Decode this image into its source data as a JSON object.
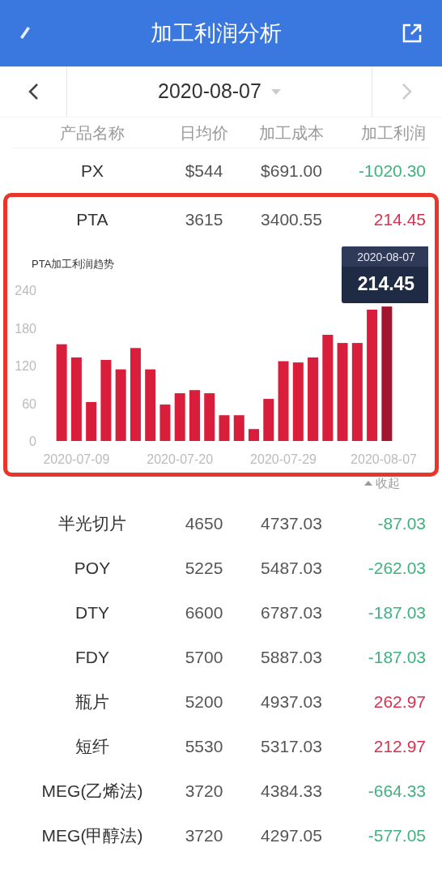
{
  "header": {
    "title": "加工利润分析"
  },
  "date_bar": {
    "date": "2020-08-07"
  },
  "table": {
    "columns": [
      "产品名称",
      "日均价",
      "加工成本",
      "加工利润"
    ],
    "rows": [
      {
        "name": "PX",
        "price": "$544",
        "cost": "$691.00",
        "profit": "-1020.30",
        "color": "#3fb27f",
        "expanded": false
      },
      {
        "name": "PTA",
        "price": "3615",
        "cost": "3400.55",
        "profit": "214.45",
        "color": "#d9304f",
        "expanded": true,
        "chart": {
          "tooltip": {
            "title": "2020-08-07",
            "value": "214.45"
          },
          "collapse_label": "收起",
          "chart_data": {
            "type": "bar",
            "title": "PTA加工利润趋势",
            "categories": [
              null,
              "2020-07-09",
              null,
              null,
              null,
              null,
              null,
              null,
              "2020-07-20",
              null,
              null,
              null,
              null,
              null,
              null,
              "2020-07-29",
              null,
              null,
              null,
              null,
              null,
              null,
              "2020-08-07"
            ],
            "series": [
              {
                "color": "#d81e3a",
                "values": [
                  154,
                  133,
                  62,
                  129,
                  114,
                  148,
                  114,
                  58,
                  76,
                  81,
                  76,
                  41,
                  41,
                  19,
                  67,
                  127,
                  125,
                  133,
                  169,
                  156,
                  156,
                  209,
                  null
                ]
              },
              {
                "color": "#a3142e",
                "values": [
                  null,
                  null,
                  null,
                  null,
                  null,
                  null,
                  null,
                  null,
                  null,
                  null,
                  null,
                  null,
                  null,
                  null,
                  null,
                  null,
                  null,
                  null,
                  null,
                  null,
                  null,
                  null,
                  214
                ]
              }
            ],
            "ylim": [
              0,
              240
            ],
            "yticks": [
              0,
              60,
              120,
              180,
              240
            ]
          }
        }
      },
      {
        "name": "半光切片",
        "price": "4650",
        "cost": "4737.03",
        "profit": "-87.03",
        "color": "#3fb27f",
        "expanded": false
      },
      {
        "name": "POY",
        "price": "5225",
        "cost": "5487.03",
        "profit": "-262.03",
        "color": "#3fb27f",
        "expanded": false
      },
      {
        "name": "DTY",
        "price": "6600",
        "cost": "6787.03",
        "profit": "-187.03",
        "color": "#3fb27f",
        "expanded": false
      },
      {
        "name": "FDY",
        "price": "5700",
        "cost": "5887.03",
        "profit": "-187.03",
        "color": "#3fb27f",
        "expanded": false
      },
      {
        "name": "瓶片",
        "price": "5200",
        "cost": "4937.03",
        "profit": "262.97",
        "color": "#d9304f",
        "expanded": false
      },
      {
        "name": "短纤",
        "price": "5530",
        "cost": "5317.03",
        "profit": "212.97",
        "color": "#d9304f",
        "expanded": false
      },
      {
        "name": "MEG(乙烯法)",
        "price": "3720",
        "cost": "4384.33",
        "profit": "-664.33",
        "color": "#3fb27f",
        "expanded": false
      },
      {
        "name": "MEG(甲醇法)",
        "price": "3720",
        "cost": "4297.05",
        "profit": "-577.05",
        "color": "#3fb27f",
        "expanded": false
      }
    ]
  }
}
